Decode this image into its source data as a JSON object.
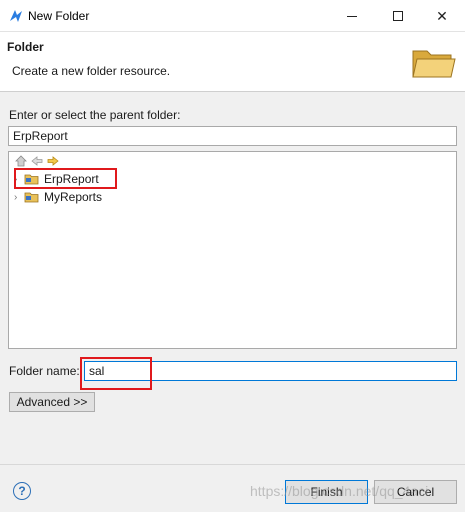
{
  "window": {
    "title": "New Folder"
  },
  "header": {
    "title": "Folder",
    "description": "Create a new folder resource."
  },
  "parent": {
    "label": "Enter or select the parent folder:",
    "value": "ErpReport"
  },
  "tree": {
    "items": [
      {
        "label": "ErpReport",
        "highlighted": true
      },
      {
        "label": "MyReports",
        "highlighted": false
      }
    ]
  },
  "folder_name": {
    "label": "Folder name:",
    "value": "sal"
  },
  "advanced": {
    "label": "Advanced >>"
  },
  "footer": {
    "finish_label": "Finish",
    "cancel_label": "Cancel",
    "help_glyph": "?"
  },
  "watermark": "https://blog.csdn.net/qq_4aci",
  "colors": {
    "highlight": "#e0191c",
    "focus": "#0078d7",
    "folder": "#e8c15a"
  }
}
